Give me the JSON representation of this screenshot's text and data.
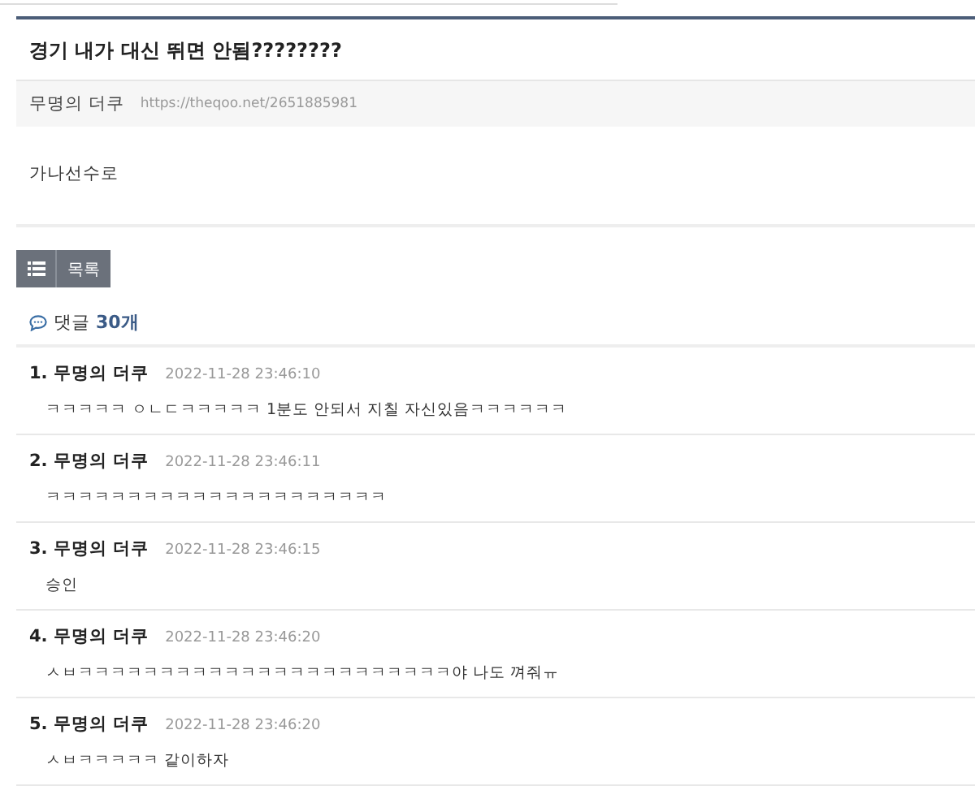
{
  "post": {
    "title": "경기 내가 대신 뛰면 안됨????????",
    "author": "무명의 더쿠",
    "url": "https://theqoo.net/2651885981",
    "body": "가나선수로"
  },
  "list_button": {
    "label": "목록"
  },
  "comments_header": {
    "label": "댓글",
    "count": "30개"
  },
  "comments": [
    {
      "number": "1.",
      "author": "무명의 더쿠",
      "time": "2022-11-28 23:46:10",
      "text": "ㅋㅋㅋㅋㅋ ㅇㄴㄷㅋㅋㅋㅋㅋ 1분도 안되서 지칠 자신있음ㅋㅋㅋㅋㅋㅋ"
    },
    {
      "number": "2.",
      "author": "무명의 더쿠",
      "time": "2022-11-28 23:46:11",
      "text": "ㅋㅋㅋㅋㅋㅋㅋㅋㅋㅋㅋㅋㅋㅋㅋㅋㅋㅋㅋㅋㅋ"
    },
    {
      "number": "3.",
      "author": "무명의 더쿠",
      "time": "2022-11-28 23:46:15",
      "text": "승인"
    },
    {
      "number": "4.",
      "author": "무명의 더쿠",
      "time": "2022-11-28 23:46:20",
      "text": "ㅅㅂㅋㅋㅋㅋㅋㅋㅋㅋㅋㅋㅋㅋㅋㅋㅋㅋㅋㅋㅋㅋㅋㅋㅋ야 나도 껴줘ㅠ"
    },
    {
      "number": "5.",
      "author": "무명의 더쿠",
      "time": "2022-11-28 23:46:20",
      "text": "ㅅㅂㅋㅋㅋㅋㅋ 같이하자"
    }
  ]
}
